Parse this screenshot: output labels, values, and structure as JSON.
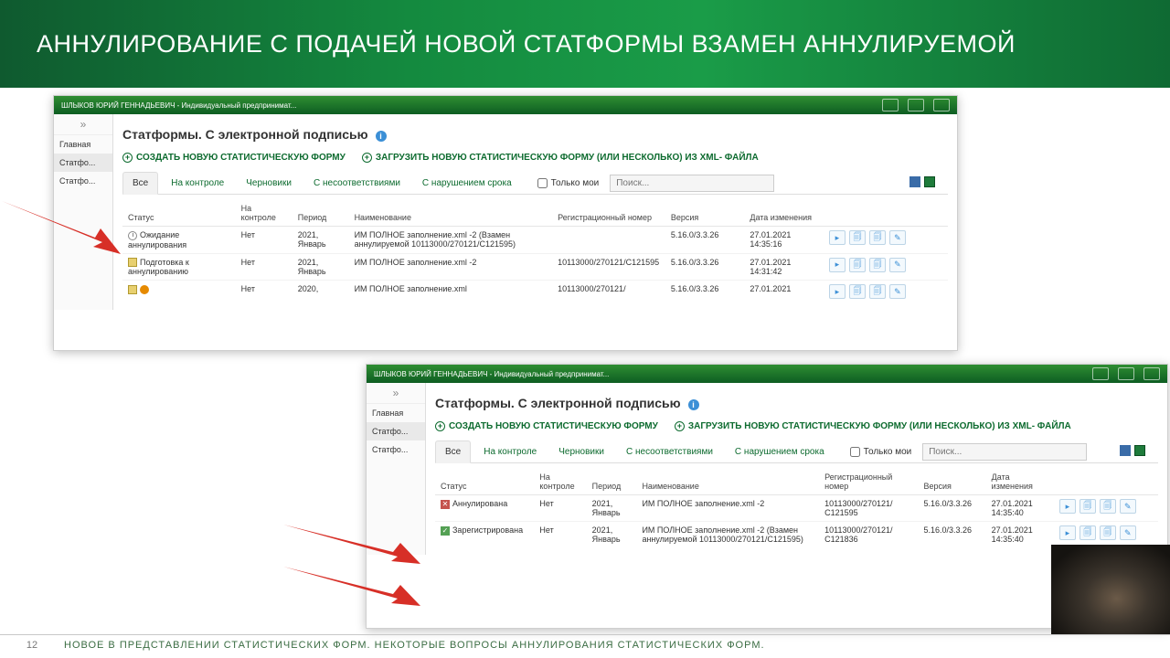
{
  "slide": {
    "title": "АННУЛИРОВАНИЕ С ПОДАЧЕЙ НОВОЙ СТАТФОРМЫ ВЗАМЕН АННУЛИРУЕМОЙ",
    "page_number": "12",
    "footer_text": "НОВОЕ В ПРЕДСТАВЛЕНИИ СТАТИСТИЧЕСКИХ ФОРМ.  НЕКОТОРЫЕ ВОПРОСЫ АННУЛИРОВАНИЯ СТАТИСТИЧЕСКИХ ФОРМ."
  },
  "common": {
    "topbar_user": "ШЛЫКОВ ЮРИЙ ГЕННАДЬЕВИЧ - Индивидуальный предпринимат...",
    "collapse_glyph": "»",
    "sidebar": [
      "Главная",
      "Статфо...",
      "Статфо..."
    ],
    "page_heading": "Статформы. С электронной подписью",
    "create_link": "СОЗДАТЬ НОВУЮ СТАТИСТИЧЕСКУЮ ФОРМУ",
    "upload_link": "ЗАГРУЗИТЬ НОВУЮ СТАТИСТИЧЕСКУЮ ФОРМУ (ИЛИ НЕСКОЛЬКО) ИЗ XML- ФАЙЛА",
    "tabs": [
      "Все",
      "На контроле",
      "Черновики",
      "С несоответствиями",
      "С нарушением срока"
    ],
    "only_mine": "Только мои",
    "search_placeholder": "Поиск...",
    "columns": {
      "status": "Статус",
      "on_control": "На контроле",
      "period": "Период",
      "name": "Наименование",
      "reg_no": "Регистрационный номер",
      "version": "Версия",
      "changed": "Дата изменения"
    }
  },
  "panel1_rows": [
    {
      "status": "Ожидание аннулирования",
      "on_control": "Нет",
      "period": "2021, Январь",
      "name": "ИМ ПОЛНОЕ заполнение.xml -2 (Взамен аннулируемой 10113000/270121/С121595)",
      "reg_no": "",
      "version": "5.16.0/3.3.26",
      "changed": "27.01.2021 14:35:16",
      "icon": "clock"
    },
    {
      "status": "Подготовка к аннулированию",
      "on_control": "Нет",
      "period": "2021, Январь",
      "name": "ИМ ПОЛНОЕ заполнение.xml -2",
      "reg_no": "10113000/270121/С121595",
      "version": "5.16.0/3.3.26",
      "changed": "27.01.2021 14:31:42",
      "icon": "doc"
    },
    {
      "status": "",
      "on_control": "Нет",
      "period": "2020,",
      "name": "ИМ ПОЛНОЕ заполнение.xml",
      "reg_no": "10113000/270121/",
      "version": "5.16.0/3.3.26",
      "changed": "27.01.2021",
      "icon": "warn"
    }
  ],
  "panel2_rows": [
    {
      "status": "Аннулирована",
      "on_control": "Нет",
      "period": "2021, Январь",
      "name": "ИМ ПОЛНОЕ заполнение.xml -2",
      "reg_no": "10113000/270121/С121595",
      "version": "5.16.0/3.3.26",
      "changed": "27.01.2021 14:35:40",
      "icon": "cancel"
    },
    {
      "status": "Зарегистрирована",
      "on_control": "Нет",
      "period": "2021, Январь",
      "name": "ИМ ПОЛНОЕ заполнение.xml -2 (Взамен аннулируемой 10113000/270121/С121595)",
      "reg_no": "10113000/270121/С121836",
      "version": "5.16.0/3.3.26",
      "changed": "27.01.2021 14:35:40",
      "icon": "ok"
    }
  ]
}
